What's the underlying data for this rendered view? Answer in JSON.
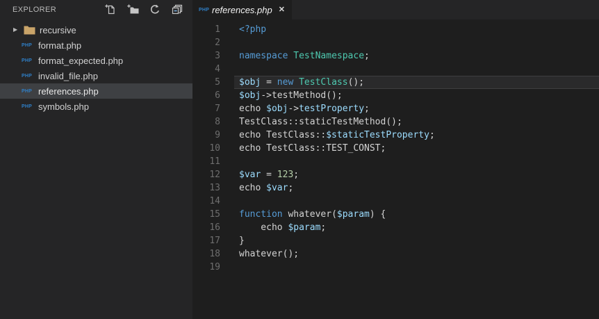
{
  "colors": {
    "editor_bg": "#1E1E1E",
    "sidebar_bg": "#252526",
    "selected_row_bg": "#3E4043",
    "keyword_blue": "#569CD6",
    "class_teal": "#4EC9B0",
    "variable_light_blue": "#9CDCFE",
    "number_green": "#B5CEA8",
    "default_text": "#D4D4D4",
    "line_number_gray": "#6E6E6E",
    "php_icon_blue": "#2F7FC6",
    "folder_tan": "#C9A469"
  },
  "sidebar": {
    "title": "EXPLORER",
    "actions": [
      {
        "name": "new-file",
        "icon": "new-file-icon"
      },
      {
        "name": "new-folder",
        "icon": "new-folder-icon"
      },
      {
        "name": "refresh",
        "icon": "refresh-icon"
      },
      {
        "name": "collapse-all",
        "icon": "collapse-all-icon"
      }
    ],
    "tree": [
      {
        "kind": "folder",
        "label": "recursive",
        "state": "collapsed",
        "selected": false
      },
      {
        "kind": "php-file",
        "label": "format.php",
        "selected": false
      },
      {
        "kind": "php-file",
        "label": "format_expected.php",
        "selected": false
      },
      {
        "kind": "php-file",
        "label": "invalid_file.php",
        "selected": false
      },
      {
        "kind": "php-file",
        "label": "references.php",
        "selected": true
      },
      {
        "kind": "php-file",
        "label": "symbols.php",
        "selected": false
      }
    ]
  },
  "tabbar": {
    "active_tab": {
      "label": "references.php",
      "file_type_badge": "PHP",
      "close_label": "✕",
      "preview": true,
      "active": true
    }
  },
  "editor": {
    "language": "php",
    "lines": [
      {
        "n": "1",
        "hl": false,
        "tokens": [
          [
            "<?php",
            "kw"
          ]
        ]
      },
      {
        "n": "2",
        "hl": false,
        "tokens": []
      },
      {
        "n": "3",
        "hl": false,
        "tokens": [
          [
            "namespace",
            "kw"
          ],
          [
            " ",
            "def"
          ],
          [
            "TestNamespace",
            "cls"
          ],
          [
            ";",
            "def"
          ]
        ]
      },
      {
        "n": "4",
        "hl": false,
        "tokens": []
      },
      {
        "n": "5",
        "hl": true,
        "tokens": [
          [
            "$obj",
            "var"
          ],
          [
            " = ",
            "def"
          ],
          [
            "new",
            "kw"
          ],
          [
            " ",
            "def"
          ],
          [
            "TestClass",
            "cls"
          ],
          [
            "();",
            "def"
          ]
        ]
      },
      {
        "n": "6",
        "hl": false,
        "tokens": [
          [
            "$obj",
            "var"
          ],
          [
            "->testMethod();",
            "def"
          ]
        ]
      },
      {
        "n": "7",
        "hl": false,
        "tokens": [
          [
            "echo ",
            "def"
          ],
          [
            "$obj",
            "var"
          ],
          [
            "->",
            "def"
          ],
          [
            "testProperty",
            "var"
          ],
          [
            ";",
            "def"
          ]
        ]
      },
      {
        "n": "8",
        "hl": false,
        "tokens": [
          [
            "TestClass::staticTestMethod();",
            "def"
          ]
        ]
      },
      {
        "n": "9",
        "hl": false,
        "tokens": [
          [
            "echo TestClass::",
            "def"
          ],
          [
            "$staticTestProperty",
            "var"
          ],
          [
            ";",
            "def"
          ]
        ]
      },
      {
        "n": "10",
        "hl": false,
        "tokens": [
          [
            "echo TestClass::TEST_CONST;",
            "def"
          ]
        ]
      },
      {
        "n": "11",
        "hl": false,
        "tokens": []
      },
      {
        "n": "12",
        "hl": false,
        "tokens": [
          [
            "$var",
            "var"
          ],
          [
            " = ",
            "def"
          ],
          [
            "123",
            "num"
          ],
          [
            ";",
            "def"
          ]
        ]
      },
      {
        "n": "13",
        "hl": false,
        "tokens": [
          [
            "echo ",
            "def"
          ],
          [
            "$var",
            "var"
          ],
          [
            ";",
            "def"
          ]
        ]
      },
      {
        "n": "14",
        "hl": false,
        "tokens": []
      },
      {
        "n": "15",
        "hl": false,
        "tokens": [
          [
            "function",
            "kw"
          ],
          [
            " whatever(",
            "def"
          ],
          [
            "$param",
            "var"
          ],
          [
            ") {",
            "def"
          ]
        ]
      },
      {
        "n": "16",
        "hl": false,
        "tokens": [
          [
            "    echo ",
            "def"
          ],
          [
            "$param",
            "var"
          ],
          [
            ";",
            "def"
          ]
        ]
      },
      {
        "n": "17",
        "hl": false,
        "tokens": [
          [
            "}",
            "def"
          ]
        ]
      },
      {
        "n": "18",
        "hl": false,
        "tokens": [
          [
            "whatever();",
            "def"
          ]
        ]
      },
      {
        "n": "19",
        "hl": false,
        "tokens": []
      }
    ]
  }
}
